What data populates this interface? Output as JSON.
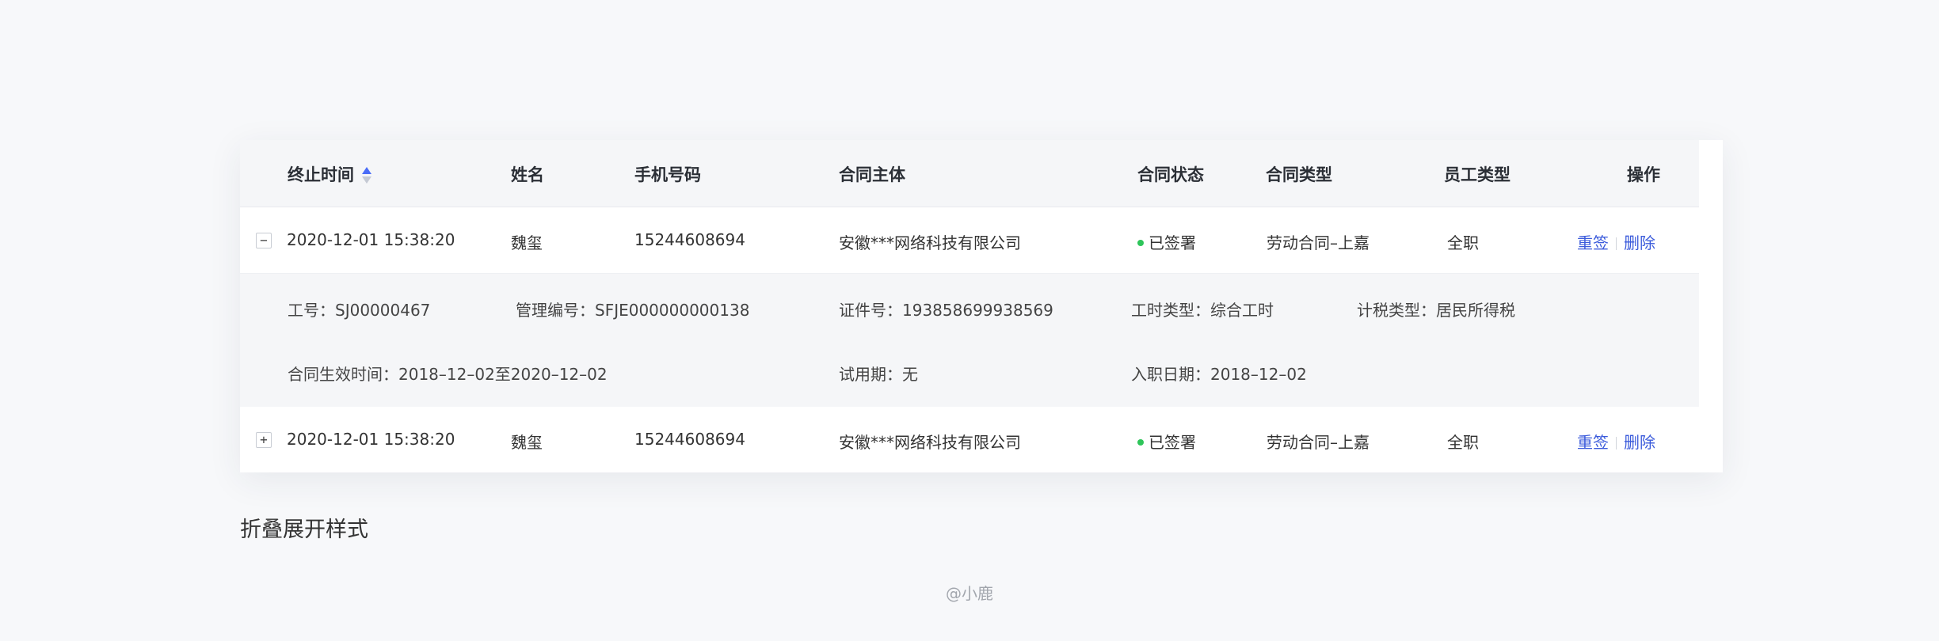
{
  "columns": {
    "end_time": "终止时间",
    "name": "姓名",
    "phone": "手机号码",
    "contract_entity": "合同主体",
    "contract_status": "合同状态",
    "contract_type": "合同类型",
    "employee_type": "员工类型",
    "actions": "操作"
  },
  "rows": [
    {
      "toggle": "−",
      "end_time": "2020-12-01 15:38:20",
      "name": "魏玺",
      "phone": "15244608694",
      "contract_entity": "安徽***网络科技有限公司",
      "contract_status": "已签署",
      "contract_type": "劳动合同–上嘉",
      "employee_type": "全职",
      "action_resign": "重签",
      "action_delete": "删除"
    },
    {
      "toggle": "+",
      "end_time": "2020-12-01 15:38:20",
      "name": "魏玺",
      "phone": "15244608694",
      "contract_entity": "安徽***网络科技有限公司",
      "contract_status": "已签署",
      "contract_type": "劳动合同–上嘉",
      "employee_type": "全职",
      "action_resign": "重签",
      "action_delete": "删除"
    }
  ],
  "detail": {
    "employee_no": "工号：SJ00000467",
    "management_no": "管理编号：SFJE000000000138",
    "certificate_no": "证件号：193858699938569",
    "work_hours_type": "工时类型：综合工时",
    "tax_type": "计税类型：居民所得税",
    "contract_effective": "合同生效时间：2018–12–02至2020–12–02",
    "probation": "试用期：无",
    "entry_date": "入职日期：2018–12–02"
  },
  "caption": "折叠展开样式",
  "watermark": "@小鹿",
  "colors": {
    "accent": "#3b5bdb",
    "status_signed": "#2ec55a",
    "header_bg": "#f5f6f8"
  }
}
